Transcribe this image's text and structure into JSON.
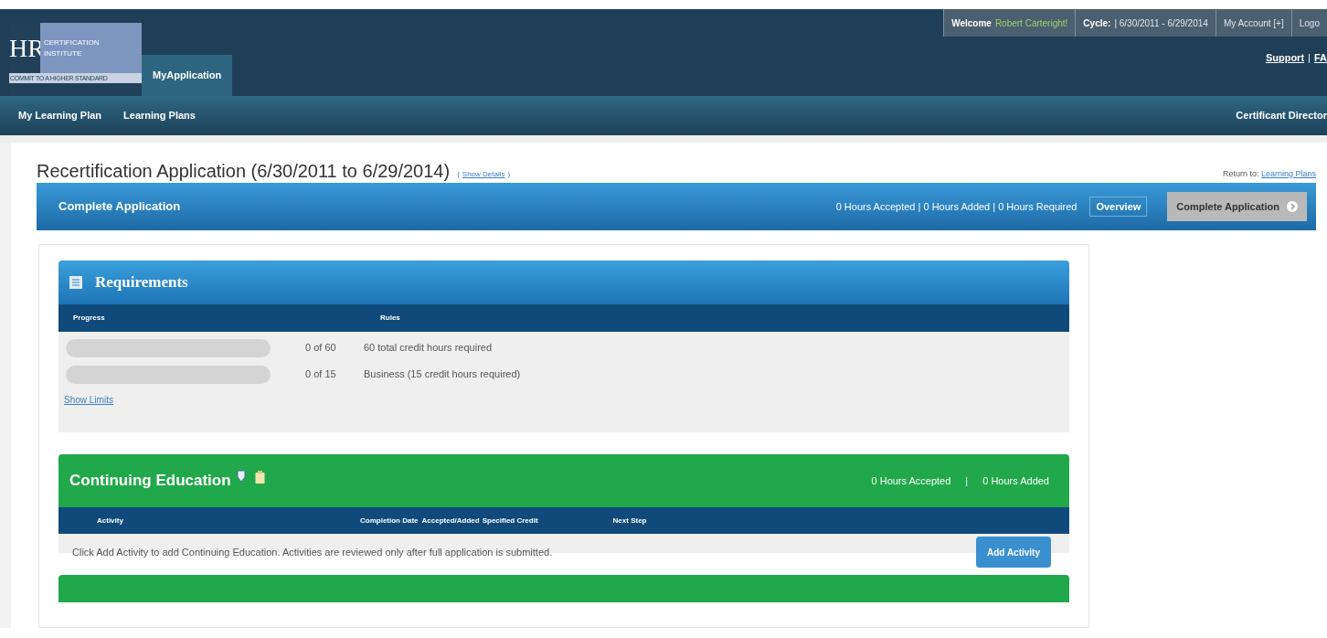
{
  "header": {
    "logo": {
      "letters": "HR",
      "line_1": "CERTIFICATION",
      "line_2": "INSTITUTE",
      "tagline": "COMMIT TO A HIGHER STANDARD"
    },
    "top_bar": [
      {
        "label": "Welcome",
        "value": "Robert Carteright!"
      },
      {
        "label": "Cycle:",
        "value": "| 6/30/2011 - 6/29/2014"
      },
      {
        "value": "My Account [+]"
      },
      {
        "value": "Logo"
      }
    ],
    "links": [
      "Support",
      "|",
      "FA"
    ],
    "tabs": [
      {
        "label": "MyApplication",
        "selected": true
      }
    ],
    "nav": [
      "My Learning Plan",
      "Learning Plans"
    ],
    "nav_right": "Certificant Director"
  },
  "page": {
    "title": "Recertification Application (6/30/2011 to 6/29/2014)",
    "details_open": "(",
    "details_link": "Show Details",
    "details_close": ")",
    "return_label": "Return to:",
    "return_link": "Learning Plans"
  },
  "application_bar": {
    "title": "Complete Application",
    "summary": "0 Hours Accepted | 0 Hours Added | 0 Hours Required",
    "overview": "Overview",
    "button": "Complete Application"
  },
  "requirements": {
    "title": "Requirements",
    "columns": [
      "Progress",
      "Rules"
    ],
    "rows": [
      {
        "level": 0,
        "count": "0 of 60",
        "rule": "60 total credit hours required"
      },
      {
        "level": 0,
        "count": "0 of 15",
        "rule": "Business (15 credit hours required)"
      }
    ],
    "show_limits": "Show Limits"
  },
  "continuing_education": {
    "title": "Continuing Education",
    "summary": [
      "0 Hours Accepted",
      "|",
      "0 Hours Added"
    ],
    "columns": [
      "Activity",
      "Completion Date",
      "Accepted/Added",
      "Specified Credit",
      "Next Step"
    ],
    "message": "Click Add Activity to add Continuing Education. Activities are reviewed only after full application is submitted.",
    "button": "Add Activity"
  }
}
